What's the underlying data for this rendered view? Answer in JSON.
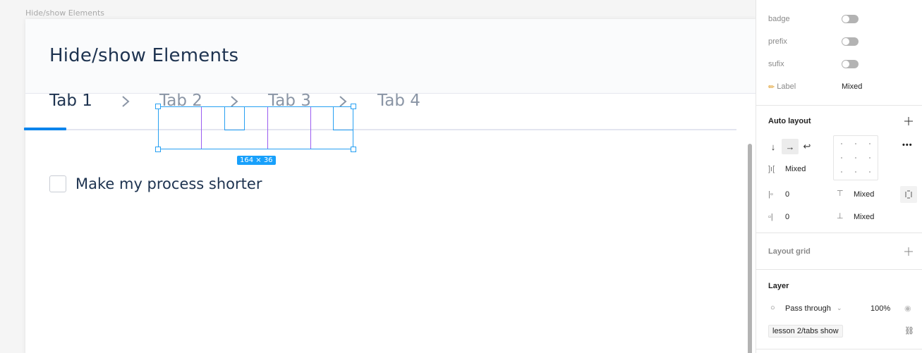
{
  "canvas": {
    "frame_label": "Hide/show Elements",
    "frame_title": "Hide/show Elements",
    "tabs": [
      {
        "label": "Tab 1",
        "state": "active"
      },
      {
        "label": "Tab 2",
        "state": "inactive"
      },
      {
        "label": "Tab 3",
        "state": "inactive"
      },
      {
        "label": "Tab 4",
        "state": "inactive"
      }
    ],
    "selection_size": "164 × 36",
    "checkbox": {
      "label": "Make my process shorter",
      "checked": false
    },
    "colors": {
      "accent": "#0b84ec",
      "selection": "#18a0fb",
      "component": "#9b5cf0",
      "title": "#1e3350",
      "inactive_tab": "#8a95a5"
    }
  },
  "panel": {
    "properties": [
      {
        "label": "badge",
        "type": "toggle",
        "value": false
      },
      {
        "label": "prefix",
        "type": "toggle",
        "value": false
      },
      {
        "label": "sufix",
        "type": "toggle",
        "value": false
      },
      {
        "label": "Label",
        "type": "text",
        "value": "Mixed",
        "icon": "pencil-icon"
      }
    ],
    "auto_layout": {
      "title": "Auto layout",
      "direction": "horizontal",
      "spacing": "Mixed",
      "padding_left": "0",
      "padding_right": "0",
      "padding_top": "Mixed",
      "padding_bottom": "Mixed"
    },
    "layout_grid": {
      "title": "Layout grid"
    },
    "layer": {
      "title": "Layer",
      "blend_mode": "Pass through",
      "opacity": "100%",
      "component_name": "lesson 2/tabs show"
    }
  }
}
